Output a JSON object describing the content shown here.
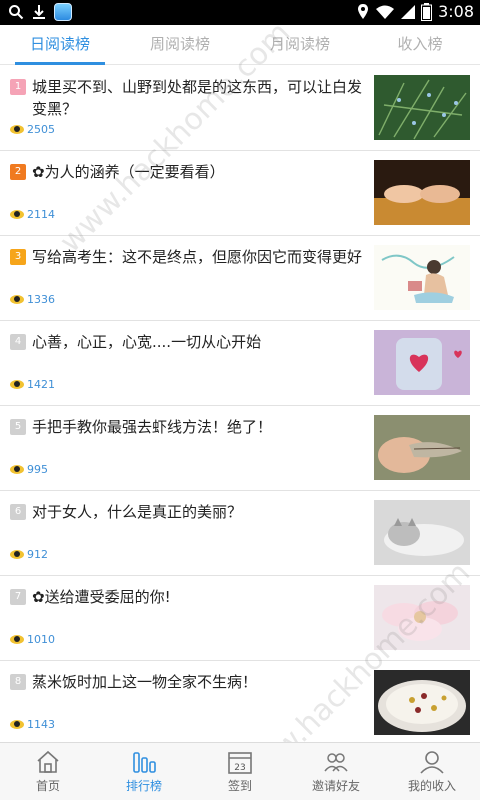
{
  "status_bar": {
    "time": "3:08"
  },
  "tabs": [
    {
      "label": "日阅读榜",
      "active": true
    },
    {
      "label": "周阅读榜",
      "active": false
    },
    {
      "label": "月阅读榜",
      "active": false
    },
    {
      "label": "收入榜",
      "active": false
    }
  ],
  "articles": [
    {
      "rank": "1",
      "title": "城里买不到、山野到处都是的这东西，可以让白发变黑？",
      "views": "2505",
      "thumb": "rosemary-plant"
    },
    {
      "rank": "2",
      "title": "✿为人的涵养（一定要看看）",
      "views": "2114",
      "thumb": "hands-on-table"
    },
    {
      "rank": "3",
      "title": "写给高考生：这不是终点，但愿你因它而变得更好",
      "views": "1336",
      "thumb": "girl-reading-illustration"
    },
    {
      "rank": "4",
      "title": "心善，心正，心宽....一切从心开始",
      "views": "1421",
      "thumb": "heart-jar"
    },
    {
      "rank": "5",
      "title": "手把手教你最强去虾线方法！绝了！",
      "views": "995",
      "thumb": "shrimp-in-hand"
    },
    {
      "rank": "6",
      "title": "对于女人，什么是真正的美丽？",
      "views": "912",
      "thumb": "sleeping-cat"
    },
    {
      "rank": "7",
      "title": "✿送给遭受委屈的你!",
      "views": "1010",
      "thumb": "pink-flower"
    },
    {
      "rank": "8",
      "title": "蒸米饭时加上这一物全家不生病！",
      "views": "1143",
      "thumb": "rice-bowl"
    }
  ],
  "bottom_nav": [
    {
      "label": "首页",
      "icon": "home-icon",
      "active": false
    },
    {
      "label": "排行榜",
      "icon": "ranking-bars-icon",
      "active": true
    },
    {
      "label": "签到",
      "icon": "calendar-icon",
      "active": false,
      "badge": "23"
    },
    {
      "label": "邀请好友",
      "icon": "invite-friends-icon",
      "active": false
    },
    {
      "label": "我的收入",
      "icon": "user-icon",
      "active": false
    }
  ],
  "watermark": "www.hackhome.com",
  "colors": {
    "accent": "#2f8fe0",
    "view_count": "#3f8fd6"
  }
}
